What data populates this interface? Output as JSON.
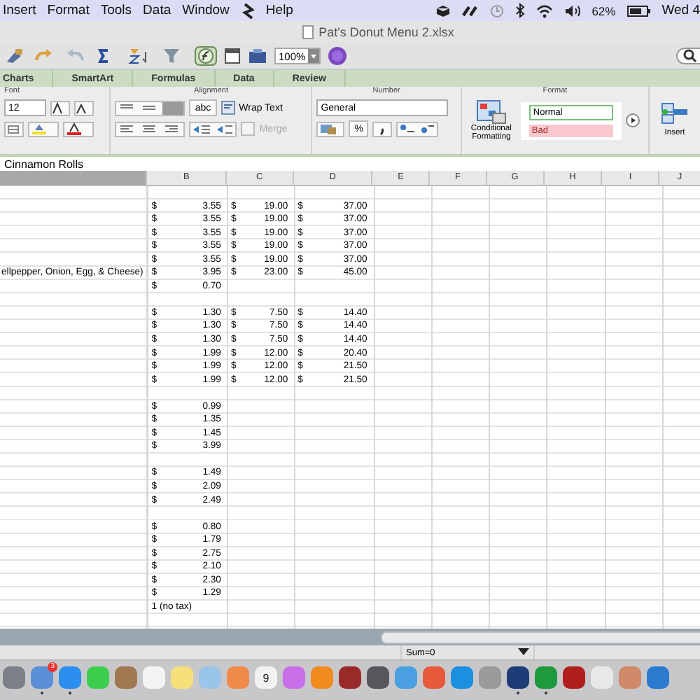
{
  "menu_bar": {
    "items": [
      "Insert",
      "Format",
      "Tools",
      "Data",
      "Window"
    ],
    "help": "Help",
    "battery": "62%",
    "clock": "Wed 4"
  },
  "window": {
    "title": "Pat's Donut Menu 2.xlsx"
  },
  "toolbar": {
    "zoom": "100%"
  },
  "ribbon_tabs": [
    {
      "label": "Charts",
      "selected": false
    },
    {
      "label": "SmartArt",
      "selected": false
    },
    {
      "label": "Formulas",
      "selected": false
    },
    {
      "label": "Data",
      "selected": false
    },
    {
      "label": "Review",
      "selected": false
    }
  ],
  "ribbon": {
    "font_group": "Font",
    "font_size": "12",
    "alignment_group": "Alignment",
    "abc": "abc",
    "wrap_text": "Wrap Text",
    "merge": {
      "label": "Merge",
      "disabled": true
    },
    "number_group": "Number",
    "number_format": "General",
    "percent": "%",
    "format_group": "Format",
    "conditional_formatting": "Conditional Formatting",
    "styles": [
      {
        "label": "Normal",
        "kind": "normal"
      },
      {
        "label": "Bad",
        "kind": "bad"
      }
    ],
    "insert": "Insert"
  },
  "formula_bar": {
    "value": "Cinnamon Rolls"
  },
  "columns": [
    "B",
    "C",
    "D",
    "E",
    "F",
    "G",
    "H",
    "I",
    "J"
  ],
  "rows": [
    {
      "a": "",
      "cells": []
    },
    {
      "a": "",
      "cells": [
        {
          "sym": "$",
          "amount": "3.55"
        },
        {
          "sym": "$",
          "amount": "19.00"
        },
        {
          "sym": "$",
          "amount": "37.00"
        }
      ]
    },
    {
      "a": "",
      "cells": [
        {
          "sym": "$",
          "amount": "3.55"
        },
        {
          "sym": "$",
          "amount": "19.00"
        },
        {
          "sym": "$",
          "amount": "37.00"
        }
      ]
    },
    {
      "a": "",
      "cells": [
        {
          "sym": "$",
          "amount": "3.55"
        },
        {
          "sym": "$",
          "amount": "19.00"
        },
        {
          "sym": "$",
          "amount": "37.00"
        }
      ]
    },
    {
      "a": "",
      "cells": [
        {
          "sym": "$",
          "amount": "3.55"
        },
        {
          "sym": "$",
          "amount": "19.00"
        },
        {
          "sym": "$",
          "amount": "37.00"
        }
      ]
    },
    {
      "a": "",
      "cells": [
        {
          "sym": "$",
          "amount": "3.55"
        },
        {
          "sym": "$",
          "amount": "19.00"
        },
        {
          "sym": "$",
          "amount": "37.00"
        }
      ]
    },
    {
      "a": "ellpepper, Onion, Egg, & Cheese)",
      "cells": [
        {
          "sym": "$",
          "amount": "3.95"
        },
        {
          "sym": "$",
          "amount": "23.00"
        },
        {
          "sym": "$",
          "amount": "45.00"
        }
      ]
    },
    {
      "a": "",
      "cells": [
        {
          "sym": "$",
          "amount": "0.70"
        }
      ]
    },
    {
      "a": "",
      "cells": []
    },
    {
      "a": "",
      "cells": [
        {
          "sym": "$",
          "amount": "1.30"
        },
        {
          "sym": "$",
          "amount": "7.50"
        },
        {
          "sym": "$",
          "amount": "14.40"
        }
      ]
    },
    {
      "a": "",
      "cells": [
        {
          "sym": "$",
          "amount": "1.30"
        },
        {
          "sym": "$",
          "amount": "7.50"
        },
        {
          "sym": "$",
          "amount": "14.40"
        }
      ]
    },
    {
      "a": "",
      "cells": [
        {
          "sym": "$",
          "amount": "1.30"
        },
        {
          "sym": "$",
          "amount": "7.50"
        },
        {
          "sym": "$",
          "amount": "14.40"
        }
      ]
    },
    {
      "a": "",
      "cells": [
        {
          "sym": "$",
          "amount": "1.99"
        },
        {
          "sym": "$",
          "amount": "12.00"
        },
        {
          "sym": "$",
          "amount": "20.40"
        }
      ]
    },
    {
      "a": "",
      "cells": [
        {
          "sym": "$",
          "amount": "1.99"
        },
        {
          "sym": "$",
          "amount": "12.00"
        },
        {
          "sym": "$",
          "amount": "21.50"
        }
      ]
    },
    {
      "a": "",
      "cells": [
        {
          "sym": "$",
          "amount": "1.99"
        },
        {
          "sym": "$",
          "amount": "12.00"
        },
        {
          "sym": "$",
          "amount": "21.50"
        }
      ]
    },
    {
      "a": "",
      "cells": []
    },
    {
      "a": "",
      "cells": [
        {
          "sym": "$",
          "amount": "0.99"
        }
      ]
    },
    {
      "a": "",
      "cells": [
        {
          "sym": "$",
          "amount": "1.35"
        }
      ]
    },
    {
      "a": "",
      "cells": [
        {
          "sym": "$",
          "amount": "1.45"
        }
      ]
    },
    {
      "a": "",
      "cells": [
        {
          "sym": "$",
          "amount": "3.99"
        }
      ]
    },
    {
      "a": "",
      "cells": []
    },
    {
      "a": "",
      "cells": [
        {
          "sym": "$",
          "amount": "1.49"
        }
      ]
    },
    {
      "a": "",
      "cells": [
        {
          "sym": "$",
          "amount": "2.09"
        }
      ]
    },
    {
      "a": "",
      "cells": [
        {
          "sym": "$",
          "amount": "2.49"
        }
      ]
    },
    {
      "a": "",
      "cells": []
    },
    {
      "a": "",
      "cells": [
        {
          "sym": "$",
          "amount": "0.80"
        }
      ]
    },
    {
      "a": "",
      "cells": [
        {
          "sym": "$",
          "amount": "1.79"
        }
      ]
    },
    {
      "a": "",
      "cells": [
        {
          "sym": "$",
          "amount": "2.75"
        }
      ]
    },
    {
      "a": "",
      "cells": [
        {
          "sym": "$",
          "amount": "2.10"
        }
      ]
    },
    {
      "a": "",
      "cells": [
        {
          "sym": "$",
          "amount": "2.30"
        }
      ]
    },
    {
      "a": "",
      "cells": [
        {
          "sym": "$",
          "amount": "1.29"
        }
      ]
    },
    {
      "a": "",
      "cells": [
        {
          "text": "1 (no tax)"
        }
      ]
    }
  ],
  "status_bar": {
    "sum": "Sum=0"
  },
  "dock": {
    "mail_badge": "3",
    "calendar_day": "9",
    "apps": [
      {
        "color": "#7a7f88",
        "running": false
      },
      {
        "color": "#5b8fd6",
        "running": true
      },
      {
        "color": "#2a8ff0",
        "running": true
      },
      {
        "color": "#3ccf4e",
        "running": false
      },
      {
        "color": "#a07850",
        "running": false
      },
      {
        "color": "#f4f4f4",
        "running": false
      },
      {
        "color": "#f6e07a",
        "running": false
      },
      {
        "color": "#9ac4e8",
        "running": false
      },
      {
        "color": "#f08a4a",
        "running": false
      },
      {
        "color": "#f2f2f2",
        "running": false
      },
      {
        "color": "#c86ee8",
        "running": false
      },
      {
        "color": "#f08c1e",
        "running": false
      },
      {
        "color": "#9a2a2a",
        "running": false
      },
      {
        "color": "#55575c",
        "running": false
      },
      {
        "color": "#4aa0e0",
        "running": false
      },
      {
        "color": "#e85a3c",
        "running": false
      },
      {
        "color": "#1c8fe0",
        "running": false
      },
      {
        "color": "#9a9a9a",
        "running": false
      },
      {
        "color": "#1e3c78",
        "running": true
      },
      {
        "color": "#1e9a3c",
        "running": true
      },
      {
        "color": "#b01e1e",
        "running": false
      },
      {
        "color": "#e8e8e8",
        "running": false
      },
      {
        "color": "#d08a6a",
        "running": false
      },
      {
        "color": "#2a7ad0",
        "running": false
      }
    ]
  }
}
